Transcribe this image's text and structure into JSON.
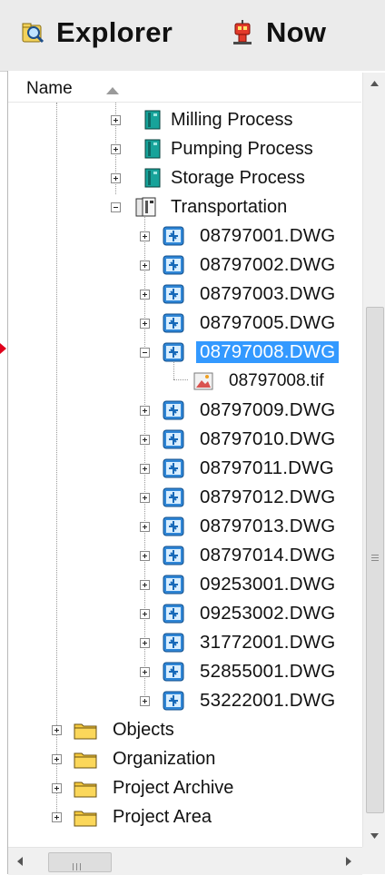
{
  "toolbar": {
    "explorer_label": "Explorer",
    "now_label": "Now"
  },
  "column_header": {
    "name_label": "Name",
    "sort": "ascending"
  },
  "colors": {
    "selection": "#3399ff",
    "marker": "#e0001b",
    "folder": "#f5c93c",
    "process_icon": "#17a39a"
  },
  "tree": {
    "milling": "Milling Process",
    "pumping": "Pumping Process",
    "storage": "Storage Process",
    "transportation": "Transportation",
    "dwg": [
      "08797001.DWG",
      "08797002.DWG",
      "08797003.DWG",
      "08797005.DWG",
      "08797008.DWG"
    ],
    "tif": "08797008.tif",
    "dwg_more": [
      "08797009.DWG",
      "08797010.DWG",
      "08797011.DWG",
      "08797012.DWG",
      "08797013.DWG",
      "08797014.DWG",
      "09253001.DWG",
      "09253002.DWG",
      "31772001.DWG",
      "52855001.DWG",
      "53222001.DWG"
    ],
    "folders": [
      "Objects",
      "Organization",
      "Project Archive",
      "Project Area"
    ],
    "selected": "08797008.DWG"
  }
}
